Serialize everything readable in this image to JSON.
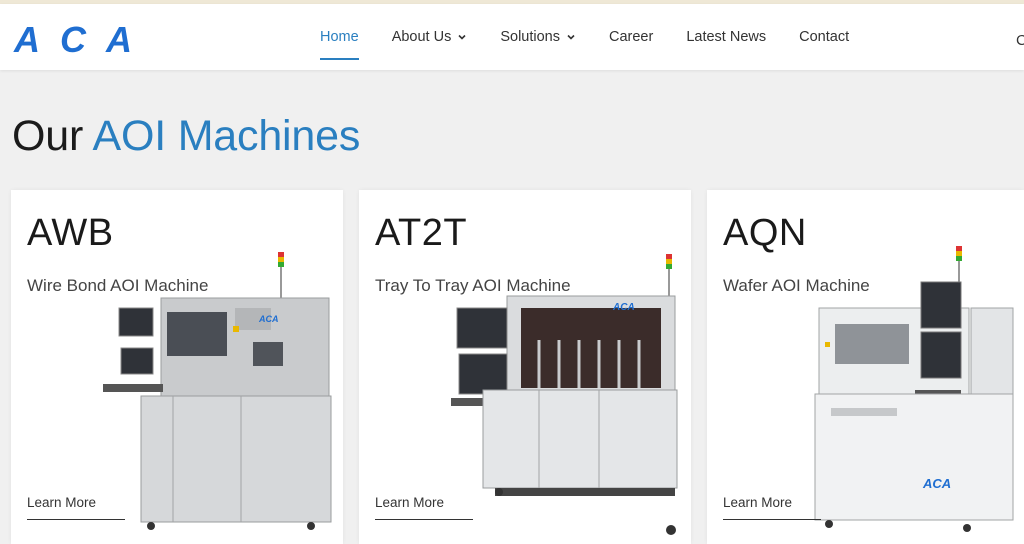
{
  "brand": {
    "logo_text": "ACA",
    "color": "#1f6ed1"
  },
  "nav": {
    "items": [
      {
        "label": "Home",
        "active": true
      },
      {
        "label": "About Us",
        "dropdown": true
      },
      {
        "label": "Solutions",
        "dropdown": true
      },
      {
        "label": "Career"
      },
      {
        "label": "Latest News"
      },
      {
        "label": "Contact"
      }
    ],
    "cut_off_text": "C"
  },
  "section": {
    "title_prefix": "Our",
    "title_accent": "AOI Machines",
    "accent_color": "#2a7fc0"
  },
  "cards": [
    {
      "model": "AWB",
      "desc": "Wire Bond AOI Machine",
      "link": "Learn More",
      "badge": "ACA"
    },
    {
      "model": "AT2T",
      "desc": "Tray To Tray AOI Machine",
      "link": "Learn More",
      "badge": "ACA"
    },
    {
      "model": "AQN",
      "desc": "Wafer AOI Machine",
      "link": "Learn More",
      "badge": "ACA"
    }
  ]
}
